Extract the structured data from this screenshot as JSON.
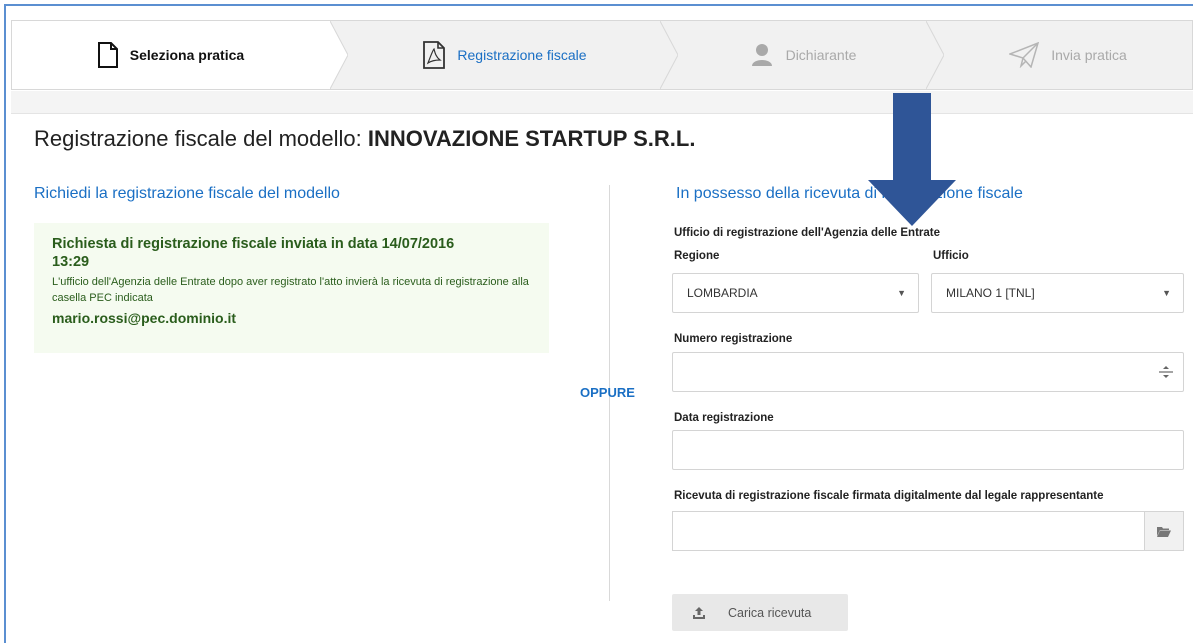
{
  "wizard": {
    "steps": [
      {
        "label": "Seleziona pratica",
        "icon": "document-icon",
        "state": "done"
      },
      {
        "label": "Registrazione fiscale",
        "icon": "pdf-document-icon",
        "state": "current"
      },
      {
        "label": "Dichiarante",
        "icon": "user-icon",
        "state": "todo"
      },
      {
        "label": "Invia pratica",
        "icon": "paper-plane-icon",
        "state": "todo"
      }
    ]
  },
  "page": {
    "title_prefix": "Registrazione fiscale del modello:",
    "title_name": "INNOVAZIONE STARTUP S.R.L."
  },
  "left": {
    "title": "Richiedi la registrazione fiscale del modello",
    "notice_title_1": "Richiesta di registrazione fiscale inviata in data",
    "notice_date": "14/07/2016",
    "notice_time": "13:29",
    "notice_text": "L'ufficio dell'Agenzia delle Entrate dopo aver registrato l'atto invierà la ricevuta di registrazione alla casella PEC indicata",
    "notice_email": "mario.rossi@pec.dominio.it"
  },
  "separator": {
    "label": "OPPURE"
  },
  "right": {
    "title": "In possesso della ricevuta di registrazione fiscale",
    "office_label": "Ufficio di registrazione dell'Agenzia delle Entrate",
    "region_label": "Regione",
    "region_value": "LOMBARDIA",
    "office_field_label": "Ufficio",
    "office_value": "MILANO 1 [TNL]",
    "number_label": "Numero registrazione",
    "number_value": "",
    "date_label": "Data registrazione",
    "date_value": "",
    "receipt_label": "Ricevuta di registrazione fiscale firmata digitalmente dal legale rappresentante",
    "receipt_value": "",
    "upload_label": "Carica ricevuta"
  },
  "colors": {
    "accent": "#1a6fc4",
    "annotation_arrow": "#2f5597",
    "notice_bg": "#f5fbf0",
    "notice_text": "#2a5d1c"
  }
}
